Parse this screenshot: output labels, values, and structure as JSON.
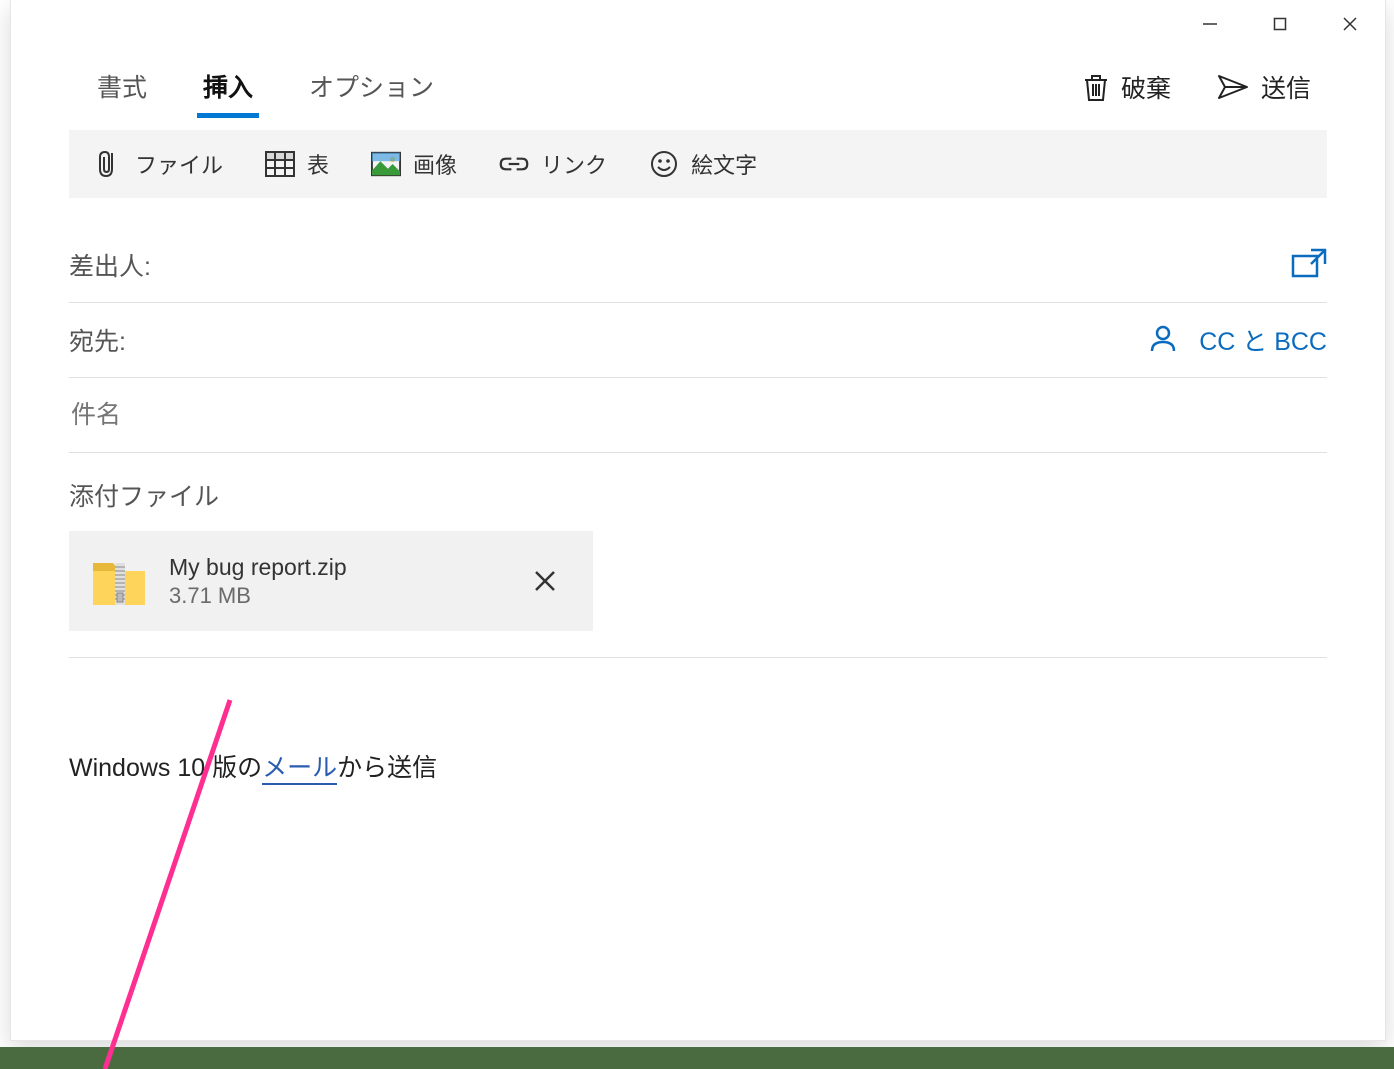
{
  "tabs": {
    "format": "書式",
    "insert": "挿入",
    "options": "オプション",
    "active": "insert"
  },
  "actions": {
    "discard": "破棄",
    "send": "送信"
  },
  "toolbar": {
    "file": "ファイル",
    "table": "表",
    "image": "画像",
    "link": "リンク",
    "emoji": "絵文字"
  },
  "fields": {
    "from_label": "差出人:",
    "from_value": "",
    "to_label": "宛先:",
    "to_value": "",
    "cc_bcc": "CC と BCC",
    "subject_placeholder": "件名",
    "subject_value": ""
  },
  "attachments": {
    "title": "添付ファイル",
    "items": [
      {
        "name": "My bug report.zip",
        "size": "3.71 MB"
      }
    ]
  },
  "body": {
    "before_link": "Windows 10 版の",
    "link_text": "メール",
    "after_link": "から送信"
  }
}
